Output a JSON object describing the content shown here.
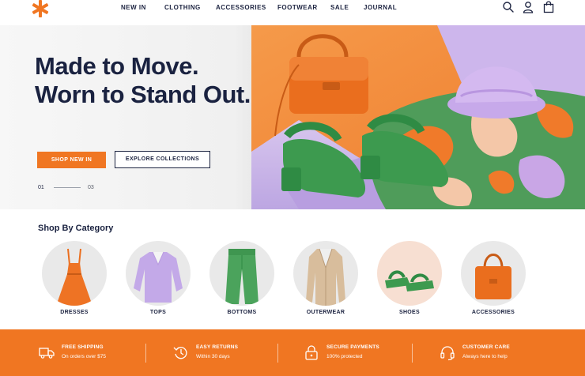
{
  "nav": {
    "logo_icon": "asterisk-logo",
    "links": [
      "NEW IN",
      "CLOTHING",
      "ACCESSORIES",
      "FOOTWEAR",
      "SALE",
      "JOURNAL"
    ],
    "icons": [
      "search-icon",
      "user-icon",
      "bag-icon"
    ]
  },
  "hero": {
    "title_line1": "Made to Move.",
    "title_line2": "Worn to Stand Out.",
    "subtitle": "",
    "primary_button": "SHOP NEW IN",
    "secondary_button": "EXPLORE COLLECTIONS",
    "slide_current": "01",
    "slide_total": "03"
  },
  "categories": {
    "title": "Shop By Category",
    "items": [
      {
        "label": "DRESSES",
        "icon": "dress-image"
      },
      {
        "label": "TOPS",
        "icon": "top-image"
      },
      {
        "label": "BOTTOMS",
        "icon": "pants-image"
      },
      {
        "label": "OUTERWEAR",
        "icon": "coat-image"
      },
      {
        "label": "SHOES",
        "icon": "sandals-image"
      },
      {
        "label": "ACCESSORIES",
        "icon": "handbag-image"
      }
    ]
  },
  "features": [
    {
      "title": "FREE SHIPPING",
      "subtitle": "On orders over $75",
      "icon": "truck-icon"
    },
    {
      "title": "EASY RETURNS",
      "subtitle": "Within 30 days",
      "icon": "return-icon"
    },
    {
      "title": "SECURE PAYMENTS",
      "subtitle": "100% protected",
      "icon": "lock-icon"
    },
    {
      "title": "CUSTOMER CARE",
      "subtitle": "Always here to help",
      "icon": "headset-icon"
    }
  ],
  "colors": {
    "accent": "#f07622",
    "navy": "#1a2240",
    "lavender": "#c9b4e8",
    "green": "#4f9c5a"
  }
}
